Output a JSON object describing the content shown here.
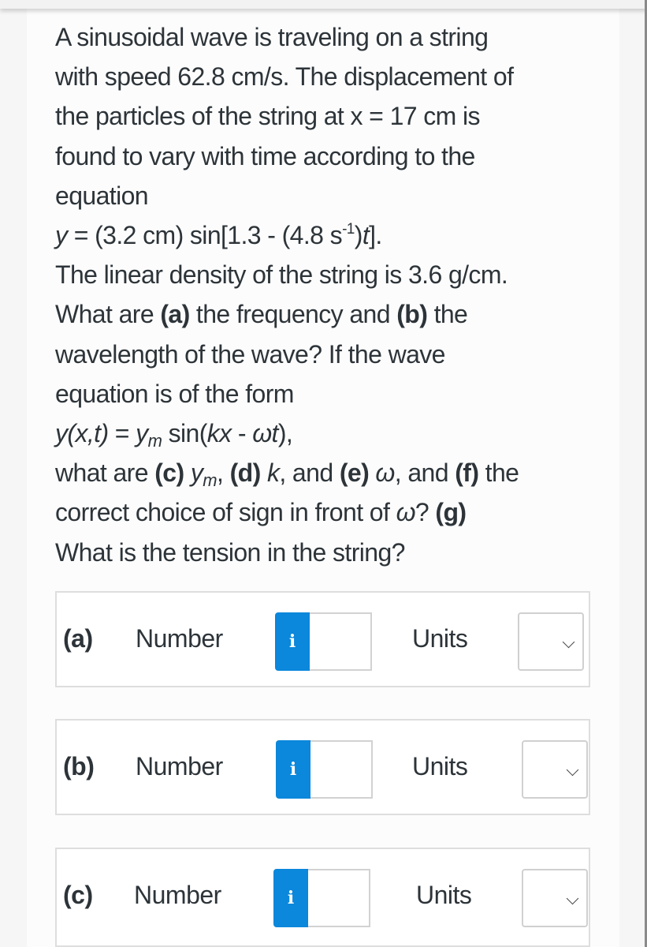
{
  "question": {
    "line1": "A sinusoidal wave is traveling on a string",
    "line2": "with speed 62.8 cm/s. The displacement of",
    "line3": "the particles of the string at x = 17 cm is",
    "line4": "found to vary with time according to the",
    "line5": "equation",
    "eq_y": "y",
    "eq_mid": " = (3.2 cm) sin[1.3 - (4.8 s",
    "eq_sup": "-1",
    "eq_close": ")",
    "eq_t": "t",
    "eq_end": "].",
    "line7": "The linear density of the string is 3.6 g/cm.",
    "line8_a": "What are ",
    "line8_a_bold": "(a)",
    "line8_b": " the frequency and ",
    "line8_b_bold": "(b)",
    "line8_c": " the",
    "line9": "wavelength of the wave? If the wave",
    "line10": "equation is of the form",
    "form_lhs": "y(x,t)",
    "form_eq": " = ",
    "form_ym": "y",
    "form_ym_sub": "m",
    "form_sin": " sin(",
    "form_kx": "kx",
    "form_minus": " - ",
    "form_wt": "ωt",
    "form_end": "),",
    "line12_a": "what are ",
    "line12_c": "(c)",
    "line12_ym": "y",
    "line12_ym_sub": "m",
    "line12_comma": ", ",
    "line12_d": "(d)",
    "line12_k": "k",
    "line12_and1": ", and ",
    "line12_e": "(e)",
    "line12_w": "ω",
    "line12_and2": ", and ",
    "line12_f": "(f)",
    "line12_the": " the",
    "line13_a": "correct choice of sign in front of ",
    "line13_w": "ω",
    "line13_q": "? ",
    "line13_g": "(g)",
    "line14": "What is the tension in the string?"
  },
  "answers": [
    {
      "part": "(a)",
      "number_label": "Number",
      "number_value": "",
      "info_icon": "i",
      "units_label": "Units",
      "units_value": ""
    },
    {
      "part": "(b)",
      "number_label": "Number",
      "number_value": "",
      "info_icon": "i",
      "units_label": "Units",
      "units_value": ""
    },
    {
      "part": "(c)",
      "number_label": "Number",
      "number_value": "",
      "info_icon": "i",
      "units_label": "Units",
      "units_value": ""
    }
  ],
  "colors": {
    "accent": "#0b87db",
    "text": "#2d3439"
  }
}
